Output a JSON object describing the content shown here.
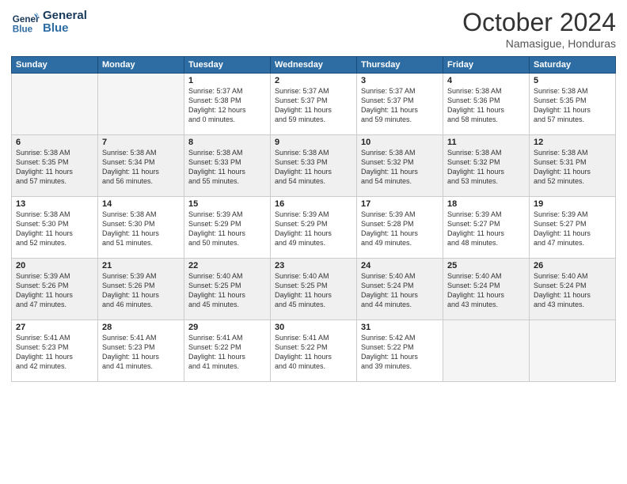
{
  "header": {
    "logo_line1": "General",
    "logo_line2": "Blue",
    "month": "October 2024",
    "location": "Namasigue, Honduras"
  },
  "weekdays": [
    "Sunday",
    "Monday",
    "Tuesday",
    "Wednesday",
    "Thursday",
    "Friday",
    "Saturday"
  ],
  "weeks": [
    [
      {
        "day": "",
        "info": "",
        "empty": true
      },
      {
        "day": "",
        "info": "",
        "empty": true
      },
      {
        "day": "1",
        "info": "Sunrise: 5:37 AM\nSunset: 5:38 PM\nDaylight: 12 hours\nand 0 minutes."
      },
      {
        "day": "2",
        "info": "Sunrise: 5:37 AM\nSunset: 5:37 PM\nDaylight: 11 hours\nand 59 minutes."
      },
      {
        "day": "3",
        "info": "Sunrise: 5:37 AM\nSunset: 5:37 PM\nDaylight: 11 hours\nand 59 minutes."
      },
      {
        "day": "4",
        "info": "Sunrise: 5:38 AM\nSunset: 5:36 PM\nDaylight: 11 hours\nand 58 minutes."
      },
      {
        "day": "5",
        "info": "Sunrise: 5:38 AM\nSunset: 5:35 PM\nDaylight: 11 hours\nand 57 minutes."
      }
    ],
    [
      {
        "day": "6",
        "info": "Sunrise: 5:38 AM\nSunset: 5:35 PM\nDaylight: 11 hours\nand 57 minutes.",
        "shaded": true
      },
      {
        "day": "7",
        "info": "Sunrise: 5:38 AM\nSunset: 5:34 PM\nDaylight: 11 hours\nand 56 minutes.",
        "shaded": true
      },
      {
        "day": "8",
        "info": "Sunrise: 5:38 AM\nSunset: 5:33 PM\nDaylight: 11 hours\nand 55 minutes.",
        "shaded": true
      },
      {
        "day": "9",
        "info": "Sunrise: 5:38 AM\nSunset: 5:33 PM\nDaylight: 11 hours\nand 54 minutes.",
        "shaded": true
      },
      {
        "day": "10",
        "info": "Sunrise: 5:38 AM\nSunset: 5:32 PM\nDaylight: 11 hours\nand 54 minutes.",
        "shaded": true
      },
      {
        "day": "11",
        "info": "Sunrise: 5:38 AM\nSunset: 5:32 PM\nDaylight: 11 hours\nand 53 minutes.",
        "shaded": true
      },
      {
        "day": "12",
        "info": "Sunrise: 5:38 AM\nSunset: 5:31 PM\nDaylight: 11 hours\nand 52 minutes.",
        "shaded": true
      }
    ],
    [
      {
        "day": "13",
        "info": "Sunrise: 5:38 AM\nSunset: 5:30 PM\nDaylight: 11 hours\nand 52 minutes."
      },
      {
        "day": "14",
        "info": "Sunrise: 5:38 AM\nSunset: 5:30 PM\nDaylight: 11 hours\nand 51 minutes."
      },
      {
        "day": "15",
        "info": "Sunrise: 5:39 AM\nSunset: 5:29 PM\nDaylight: 11 hours\nand 50 minutes."
      },
      {
        "day": "16",
        "info": "Sunrise: 5:39 AM\nSunset: 5:29 PM\nDaylight: 11 hours\nand 49 minutes."
      },
      {
        "day": "17",
        "info": "Sunrise: 5:39 AM\nSunset: 5:28 PM\nDaylight: 11 hours\nand 49 minutes."
      },
      {
        "day": "18",
        "info": "Sunrise: 5:39 AM\nSunset: 5:27 PM\nDaylight: 11 hours\nand 48 minutes."
      },
      {
        "day": "19",
        "info": "Sunrise: 5:39 AM\nSunset: 5:27 PM\nDaylight: 11 hours\nand 47 minutes."
      }
    ],
    [
      {
        "day": "20",
        "info": "Sunrise: 5:39 AM\nSunset: 5:26 PM\nDaylight: 11 hours\nand 47 minutes.",
        "shaded": true
      },
      {
        "day": "21",
        "info": "Sunrise: 5:39 AM\nSunset: 5:26 PM\nDaylight: 11 hours\nand 46 minutes.",
        "shaded": true
      },
      {
        "day": "22",
        "info": "Sunrise: 5:40 AM\nSunset: 5:25 PM\nDaylight: 11 hours\nand 45 minutes.",
        "shaded": true
      },
      {
        "day": "23",
        "info": "Sunrise: 5:40 AM\nSunset: 5:25 PM\nDaylight: 11 hours\nand 45 minutes.",
        "shaded": true
      },
      {
        "day": "24",
        "info": "Sunrise: 5:40 AM\nSunset: 5:24 PM\nDaylight: 11 hours\nand 44 minutes.",
        "shaded": true
      },
      {
        "day": "25",
        "info": "Sunrise: 5:40 AM\nSunset: 5:24 PM\nDaylight: 11 hours\nand 43 minutes.",
        "shaded": true
      },
      {
        "day": "26",
        "info": "Sunrise: 5:40 AM\nSunset: 5:24 PM\nDaylight: 11 hours\nand 43 minutes.",
        "shaded": true
      }
    ],
    [
      {
        "day": "27",
        "info": "Sunrise: 5:41 AM\nSunset: 5:23 PM\nDaylight: 11 hours\nand 42 minutes."
      },
      {
        "day": "28",
        "info": "Sunrise: 5:41 AM\nSunset: 5:23 PM\nDaylight: 11 hours\nand 41 minutes."
      },
      {
        "day": "29",
        "info": "Sunrise: 5:41 AM\nSunset: 5:22 PM\nDaylight: 11 hours\nand 41 minutes."
      },
      {
        "day": "30",
        "info": "Sunrise: 5:41 AM\nSunset: 5:22 PM\nDaylight: 11 hours\nand 40 minutes."
      },
      {
        "day": "31",
        "info": "Sunrise: 5:42 AM\nSunset: 5:22 PM\nDaylight: 11 hours\nand 39 minutes."
      },
      {
        "day": "",
        "info": "",
        "empty": true
      },
      {
        "day": "",
        "info": "",
        "empty": true
      }
    ]
  ]
}
